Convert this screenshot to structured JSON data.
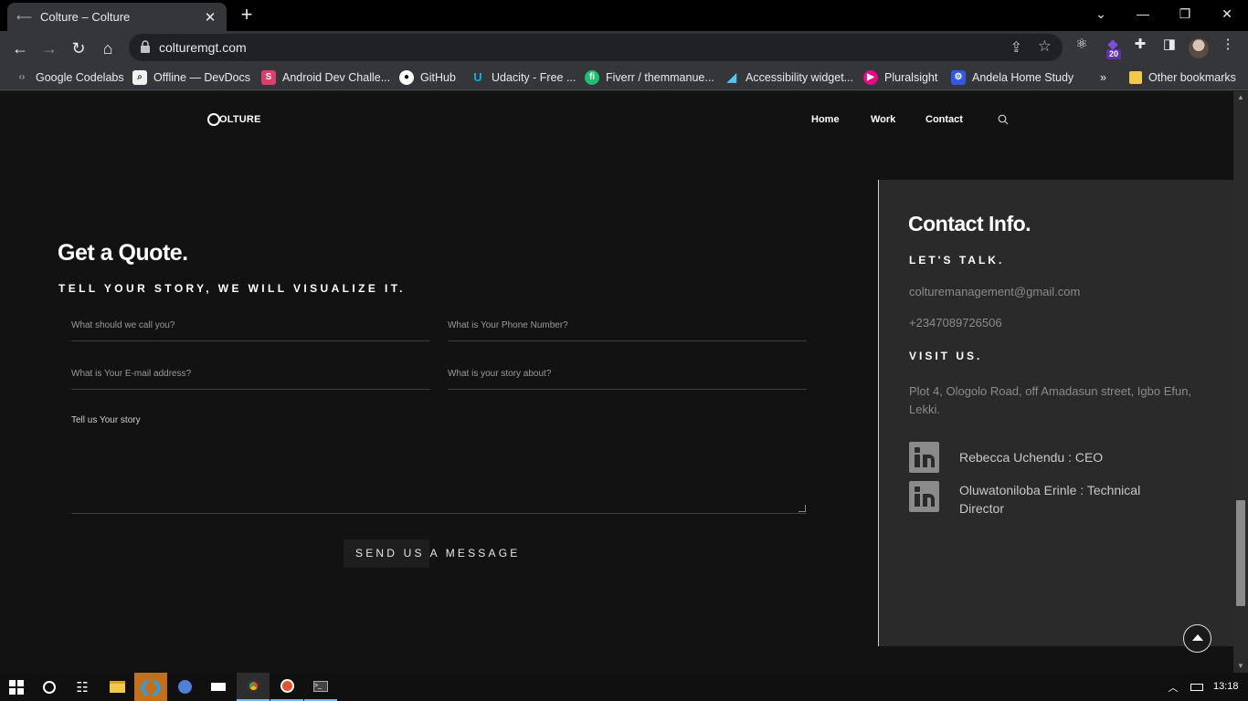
{
  "browser": {
    "tab_title": "Colture – Colture",
    "url": "colturemgt.com",
    "extension_badge": "20",
    "bookmarks": [
      {
        "label": "Google Codelabs",
        "color": "#5f6368"
      },
      {
        "label": "Offline — DevDocs",
        "color": "#f1f1f1"
      },
      {
        "label": "Android Dev Challe...",
        "color": "#d9416a"
      },
      {
        "label": "GitHub",
        "color": "#ffffff"
      },
      {
        "label": "Udacity - Free ...",
        "color": "#02b3e4"
      },
      {
        "label": "Fiverr / themmanue...",
        "color": "#1dbf73"
      },
      {
        "label": "Accessibility widget...",
        "color": "#54c5f8"
      },
      {
        "label": "Pluralsight",
        "color": "#e80a89"
      },
      {
        "label": "Andela Home Study",
        "color": "#3359df"
      }
    ],
    "bookmarks_overflow": "»",
    "other_bookmarks": "Other bookmarks"
  },
  "site": {
    "logo": "OLTURE",
    "nav": [
      "Home",
      "Work",
      "Contact"
    ]
  },
  "quote": {
    "title": "Get a Quote.",
    "subtitle": "TELL YOUR STORY, WE WILL VISUALIZE IT.",
    "name_placeholder": "What should we call you?",
    "phone_placeholder": "What is Your Phone Number?",
    "email_placeholder": "What is Your E-mail address?",
    "about_placeholder": "What is your story about?",
    "story_placeholder": "Tell us Your story",
    "send_label": "SEND US A MESSAGE"
  },
  "contact": {
    "title": "Contact Info.",
    "talk_heading": "LET'S TALK.",
    "email": "colturemanagement@gmail.com",
    "phone": "+2347089726506",
    "visit_heading": "VISIT US.",
    "address": "Plot 4, Ologolo Road, off Amadasun street, Igbo Efun, Lekki.",
    "people": [
      {
        "name": "Rebecca Uchendu : CEO"
      },
      {
        "name": "Oluwatoniloba Erinle : Technical Director"
      }
    ]
  },
  "taskbar": {
    "time": "13:18"
  }
}
